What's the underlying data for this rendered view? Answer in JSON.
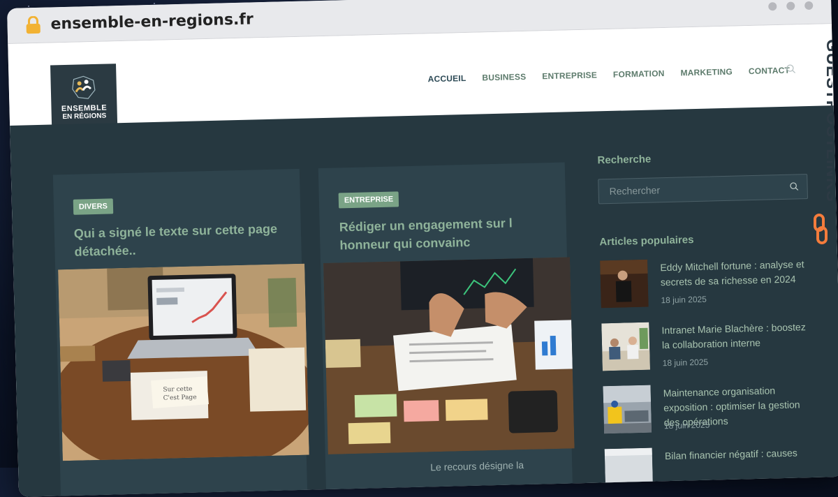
{
  "browser": {
    "url": "ensemble-en-regions.fr"
  },
  "logo": {
    "line1": "ENSEMBLE",
    "line2": "EN RÉGIONS"
  },
  "nav": {
    "items": [
      "ACCUEIL",
      "BUSINESS",
      "ENTREPRISE",
      "FORMATION",
      "MARKETING",
      "CONTACT"
    ]
  },
  "cards": [
    {
      "badge": "DIVERS",
      "title": "Qui a signé le texte sur cette page détachée..",
      "snippet": ""
    },
    {
      "badge": "ENTREPRISE",
      "title": "Rédiger un engagement sur l honneur qui convainc",
      "snippet": "Le recours désigne la"
    }
  ],
  "sidebar": {
    "search_heading": "Recherche",
    "search_placeholder": "Rechercher",
    "popular_heading": "Articles populaires",
    "popular": [
      {
        "title": "Eddy Mitchell fortune : analyse et secrets de sa richesse en 2024",
        "date": "18 juin 2025"
      },
      {
        "title": "Intranet Marie Blachère : boostez la collaboration interne",
        "date": "18 juin 2025"
      },
      {
        "title": "Maintenance organisation exposition : optimiser la gestion des opérations",
        "date": "18 juin 2025"
      },
      {
        "title": "Bilan financier négatif : causes",
        "date": ""
      }
    ]
  },
  "watermark": {
    "text": "GUESTPOSTLINKS"
  },
  "colors": {
    "accent": "#7aa386",
    "dark": "#263840",
    "card": "#2e434c",
    "logo_orange": "#f47c3c"
  }
}
